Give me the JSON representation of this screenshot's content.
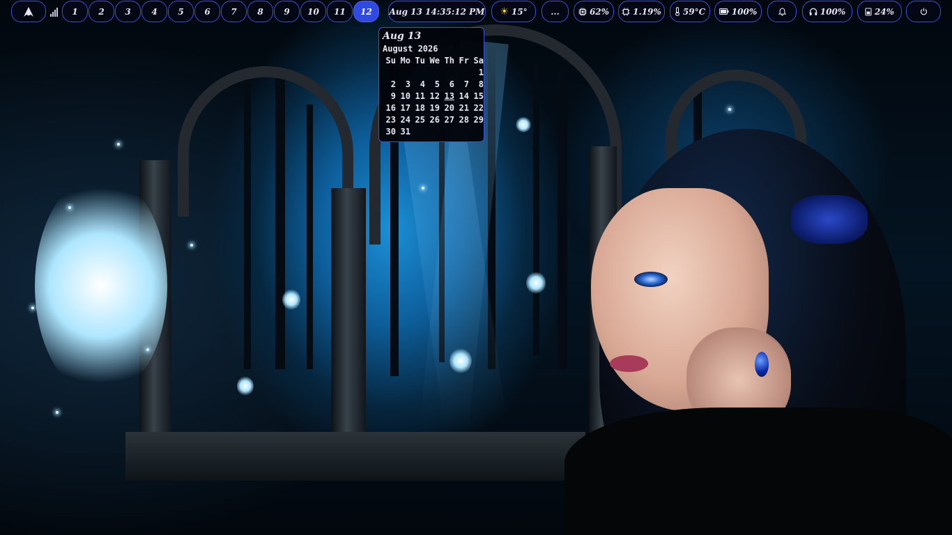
{
  "topbar": {
    "launcher_icon": "arch-logo-icon",
    "network_icon": "signal-bars-icon",
    "workspaces": [
      "1",
      "2",
      "3",
      "4",
      "5",
      "6",
      "7",
      "8",
      "9",
      "10",
      "11",
      "12"
    ],
    "active_workspace": "12",
    "clock": "Aug 13 14:35:12 PM",
    "weather": {
      "icon": "sun-icon",
      "value": "15°"
    },
    "more": "...",
    "memory": {
      "icon": "memory-chip-icon",
      "value": "62%"
    },
    "cpu": {
      "icon": "cpu-icon",
      "value": "1.19%"
    },
    "temperature": {
      "icon": "thermometer-icon",
      "value": "59°C"
    },
    "battery": {
      "icon": "battery-icon",
      "value": "100%"
    },
    "notifications": {
      "icon": "bell-icon"
    },
    "volume": {
      "icon": "headphones-icon",
      "value": "100%"
    },
    "brightness": {
      "icon": "brightness-icon",
      "value": "24%"
    },
    "power": {
      "icon": "power-icon"
    },
    "accent_color": "#3b52d8",
    "active_color": "#2f49e2",
    "background_color": "#04081"
  },
  "calendar": {
    "header": "Aug 13",
    "month_title": "August 2026",
    "weekdays": [
      "Su",
      "Mo",
      "Tu",
      "We",
      "Th",
      "Fr",
      "Sa"
    ],
    "first_weekday_index": 6,
    "days_in_month": 31,
    "today": "13"
  }
}
